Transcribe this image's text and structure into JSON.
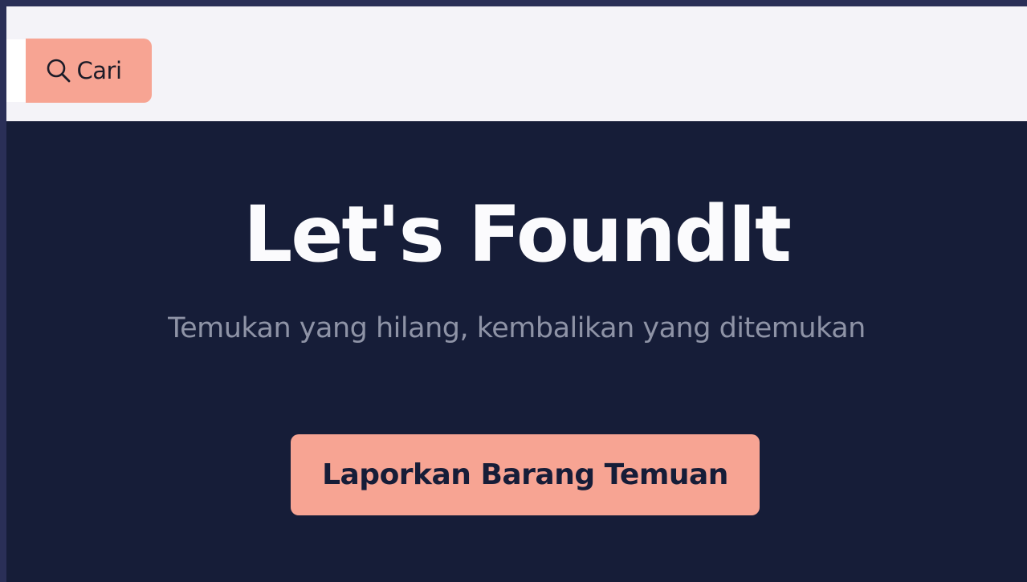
{
  "navbar": {
    "search": {
      "input_value": "",
      "button_label": "Cari",
      "icon": "search-icon"
    }
  },
  "hero": {
    "title": "Let's FoundIt",
    "subtitle": "Temukan yang hilang, kembalikan yang ditemukan",
    "cta_label": "Laporkan Barang Temuan"
  },
  "colors": {
    "background_dark": "#161d38",
    "navbar_background": "#f4f3f8",
    "accent": "#f7a493",
    "title_text": "#fbfbfd",
    "subtitle_text": "#8e93a6",
    "outer_frame": "#2a2f57"
  }
}
